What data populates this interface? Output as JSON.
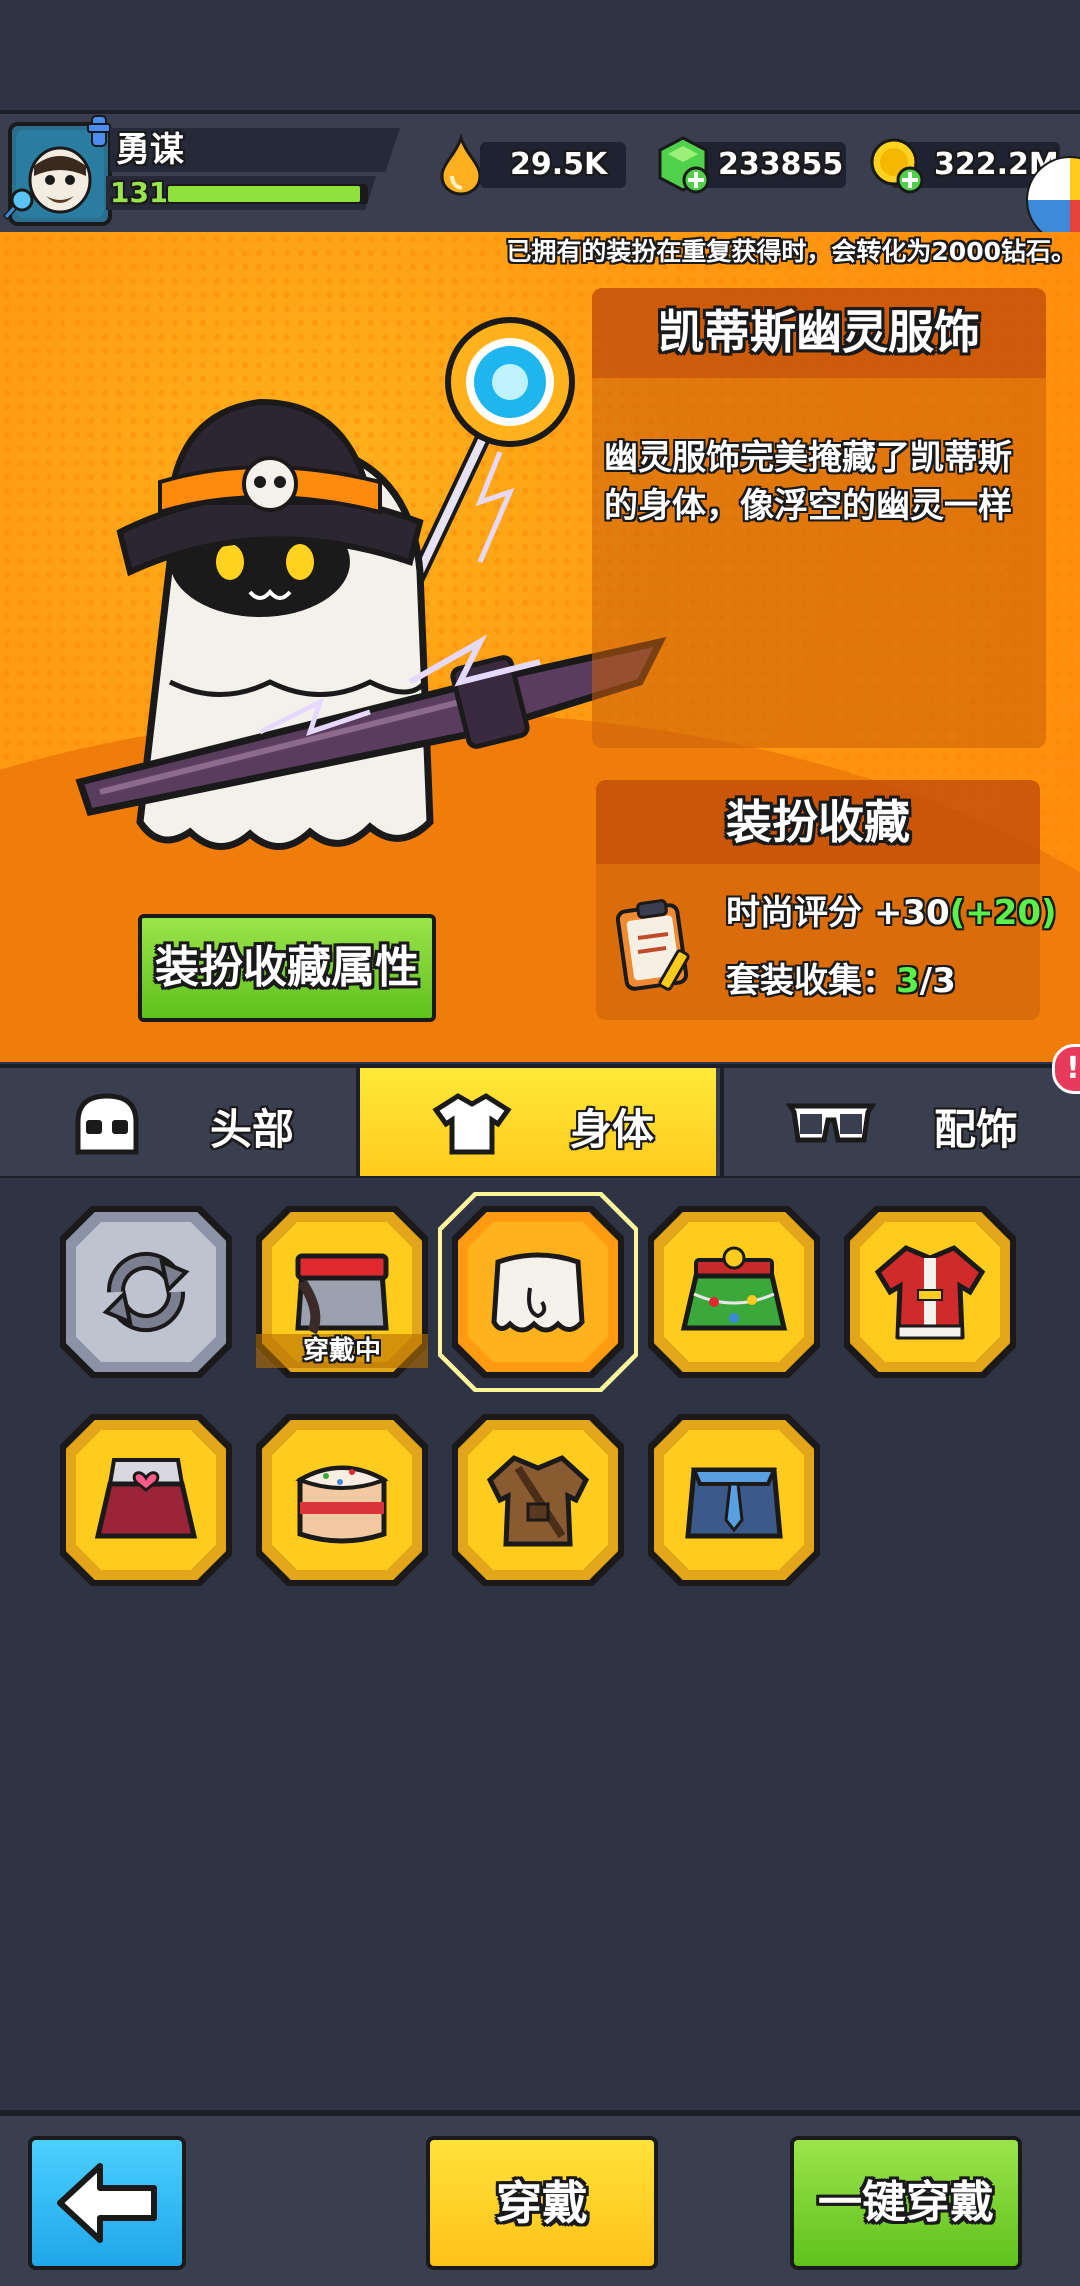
{
  "player": {
    "name": "勇谋",
    "level": "131",
    "xp_fraction": 0.97
  },
  "currencies": {
    "oil": "29.5K",
    "gems": "233855",
    "coins": "322.2M"
  },
  "notice": "已拥有的装扮在重复获得时，会转化为2000钻石。",
  "item": {
    "title": "凯蒂斯幽灵服饰",
    "description": "幽灵服饰完美掩藏了凯蒂斯的身体，像浮空的幽灵一样"
  },
  "collection": {
    "title": "装扮收藏",
    "fashion_label": "时尚评分 +30",
    "fashion_bonus": "(+20)",
    "set_label": "套装收集：",
    "set_current": "3",
    "set_total": "/3"
  },
  "collection_attr_button": "装扮收藏属性",
  "tabs": [
    {
      "label": "头部",
      "icon": "helmet-icon"
    },
    {
      "label": "身体",
      "icon": "shirt-icon",
      "active": true
    },
    {
      "label": "配饰",
      "icon": "glasses-icon"
    }
  ],
  "tab_badge": "!",
  "grid": {
    "equipped_label": "穿戴中",
    "items": [
      {
        "icon": "reset-icon"
      },
      {
        "icon": "red-sash-outfit-icon",
        "equipped": true
      },
      {
        "icon": "ghost-outfit-icon",
        "selected": true
      },
      {
        "icon": "christmas-tree-skirt-icon"
      },
      {
        "icon": "santa-coat-icon"
      },
      {
        "icon": "heart-skirt-icon"
      },
      {
        "icon": "cake-outfit-icon"
      },
      {
        "icon": "leather-jacket-icon"
      },
      {
        "icon": "blue-suit-icon"
      }
    ]
  },
  "bottom": {
    "equip_button": "穿戴",
    "one_click_button": "一键穿戴"
  },
  "colors": {
    "orange": "#ff9a12",
    "yellow": "#ffcb1c",
    "green": "#7ed321",
    "blue": "#1fb6f0",
    "dark": "#2f3444"
  }
}
